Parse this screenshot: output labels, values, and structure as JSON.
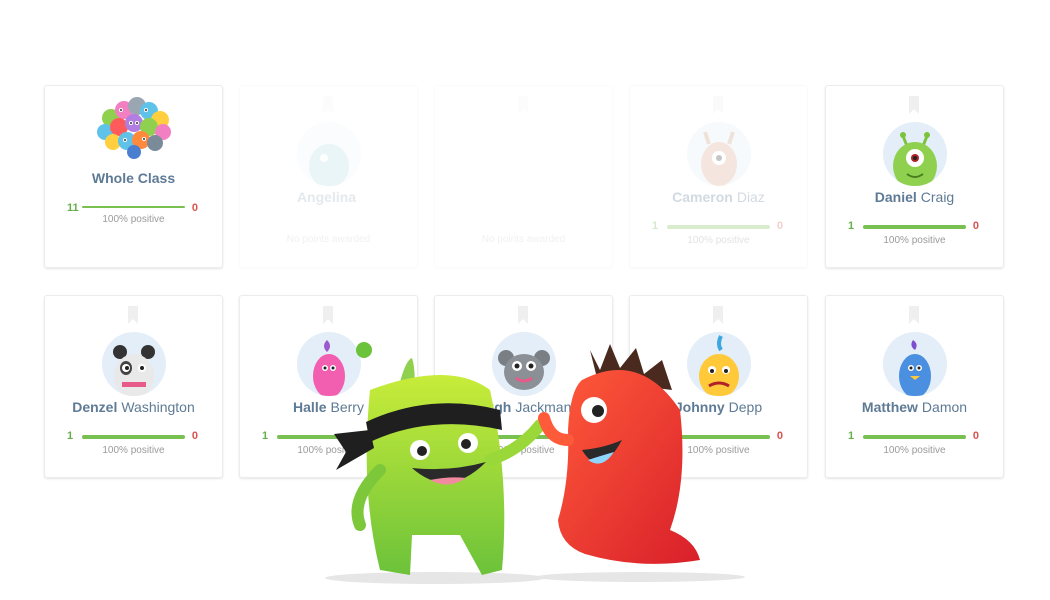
{
  "whole_class": {
    "label": "Whole Class",
    "positive_points": "11",
    "negative_points": "0",
    "positive_fraction": 1.0,
    "caption": "100% positive"
  },
  "students": [
    {
      "first": "Angelina",
      "last": "",
      "positive": "",
      "negative": "",
      "caption": "No points awarded",
      "fraction": 0,
      "avatar": "teal-horned-monster",
      "faded": true
    },
    {
      "first": "",
      "last": "",
      "positive": "",
      "negative": "",
      "caption": "No points awarded",
      "fraction": 0,
      "avatar": "none",
      "faded": true
    },
    {
      "first": "Cameron",
      "last": "Diaz",
      "positive": "1",
      "negative": "0",
      "caption": "100% positive",
      "fraction": 1.0,
      "avatar": "reindeer-monster",
      "faded": true
    },
    {
      "first": "Daniel",
      "last": "Craig",
      "positive": "1",
      "negative": "0",
      "caption": "100% positive",
      "fraction": 1.0,
      "avatar": "green-cyclops-monster",
      "faded": false
    },
    {
      "first": "Denzel",
      "last": "Washington",
      "positive": "1",
      "negative": "0",
      "caption": "100% positive",
      "fraction": 1.0,
      "avatar": "panda-monster",
      "faded": false
    },
    {
      "first": "Halle",
      "last": "Berry",
      "positive": "1",
      "negative": "0",
      "caption": "100% positive",
      "fraction": 1.0,
      "avatar": "pink-monster",
      "faded": false
    },
    {
      "first": "Hugh",
      "last": "Jackman",
      "positive": "1",
      "negative": "0",
      "caption": "100% positive",
      "fraction": 1.0,
      "avatar": "grey-mouse-monster",
      "faded": false
    },
    {
      "first": "Johnny",
      "last": "Depp",
      "positive": "1",
      "negative": "0",
      "caption": "100% positive",
      "fraction": 1.0,
      "avatar": "yellow-sad-monster",
      "faded": false
    },
    {
      "first": "Matthew",
      "last": "Damon",
      "positive": "1",
      "negative": "0",
      "caption": "100% positive",
      "fraction": 1.0,
      "avatar": "blue-bird-monster",
      "faded": false
    }
  ],
  "colors": {
    "positive": "#65b04b",
    "negative": "#d9534f",
    "name": "#5e7a95",
    "bar_fill": "#78c04f",
    "avatar_bg": "#e3eef8"
  },
  "illustration": "green-ninja-monster-and-red-monster-high-five"
}
